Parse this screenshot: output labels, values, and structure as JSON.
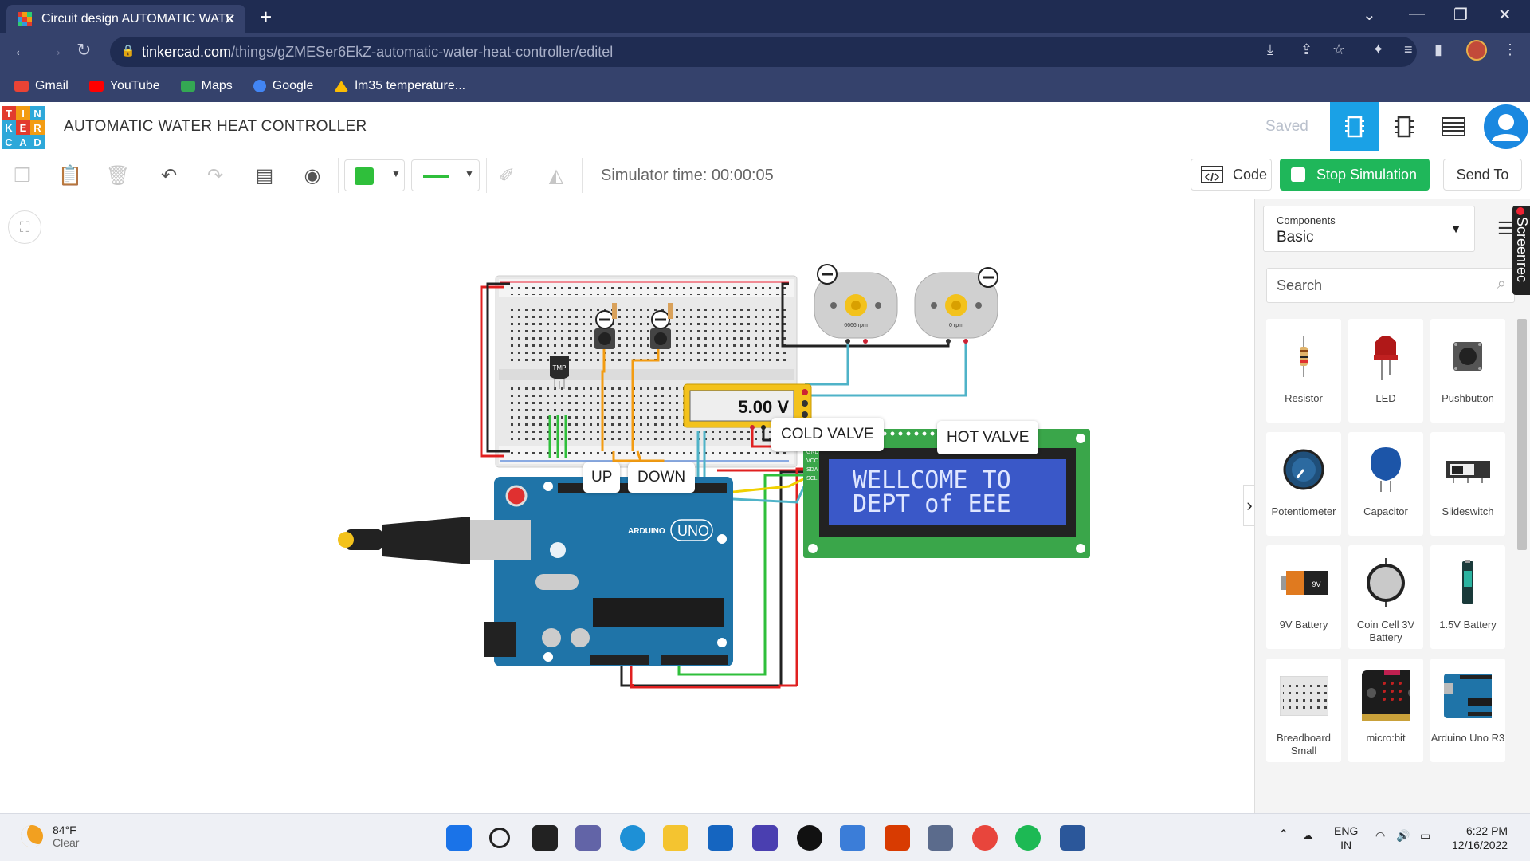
{
  "browser": {
    "tab_title": "Circuit design AUTOMATIC WATE",
    "url_host": "tinkercad.com",
    "url_path": "/things/gZMESer6EkZ-automatic-water-heat-controller/editel",
    "bookmarks": [
      {
        "label": "Gmail",
        "icon": "gmail-icon",
        "color": "#ea4335"
      },
      {
        "label": "YouTube",
        "icon": "youtube-icon",
        "color": "#ff0000"
      },
      {
        "label": "Maps",
        "icon": "maps-icon",
        "color": "#34a853"
      },
      {
        "label": "Google",
        "icon": "google-icon",
        "color": "#4285f4"
      },
      {
        "label": "lm35 temperature...",
        "icon": "drive-icon",
        "color": "#fbbc04"
      }
    ]
  },
  "app": {
    "logo_letters": [
      "T",
      "I",
      "N",
      "K",
      "E",
      "R",
      "C",
      "A",
      "D"
    ],
    "project_title": "AUTOMATIC WATER HEAT CONTROLLER",
    "save_status": "Saved",
    "accent": "#1aa1e6"
  },
  "toolbar": {
    "simulator_time": "Simulator time: 00:00:05",
    "code_label": "Code",
    "stop_label": "Stop Simulation",
    "send_label": "Send To",
    "stop_color": "#1fb75a",
    "wire_color": "#2fbf3b"
  },
  "circuit": {
    "labels": {
      "up": "UP",
      "down": "DOWN",
      "cold_valve": "COLD VALVE",
      "hot_valve": "HOT VALVE",
      "tmp": "TMP"
    },
    "multimeter": "5.00 V",
    "lcd_line1": "WELLCOME TO",
    "lcd_line2": "DEPT of EEE",
    "motor_cold_rpm": "6666 rpm",
    "motor_hot_rpm": "0 rpm",
    "arduino_model": "UNO",
    "arduino_brand": "ARDUINO",
    "lcd_pins": [
      "GND",
      "VCC",
      "SDA",
      "SCL"
    ]
  },
  "panel": {
    "components_label": "Components",
    "components_value": "Basic",
    "search_placeholder": "Search",
    "items": [
      {
        "name": "Resistor",
        "icon": "resistor-icon"
      },
      {
        "name": "LED",
        "icon": "led-icon"
      },
      {
        "name": "Pushbutton",
        "icon": "pushbutton-icon"
      },
      {
        "name": "Potentiometer",
        "icon": "potentiometer-icon"
      },
      {
        "name": "Capacitor",
        "icon": "capacitor-icon"
      },
      {
        "name": "Slideswitch",
        "icon": "slideswitch-icon"
      },
      {
        "name": "9V Battery",
        "icon": "battery-9v-icon"
      },
      {
        "name": "Coin Cell 3V Battery",
        "icon": "coin-cell-icon"
      },
      {
        "name": "1.5V Battery",
        "icon": "battery-aa-icon"
      },
      {
        "name": "Breadboard Small",
        "icon": "breadboard-icon"
      },
      {
        "name": "micro:bit",
        "icon": "microbit-icon"
      },
      {
        "name": "Arduino Uno R3",
        "icon": "arduino-icon"
      }
    ],
    "screenrec_label": "Screenrec"
  },
  "taskbar": {
    "temperature": "84°F",
    "condition": "Clear",
    "language": "ENG",
    "region": "IN",
    "time": "6:22 PM",
    "date": "12/16/2022"
  }
}
